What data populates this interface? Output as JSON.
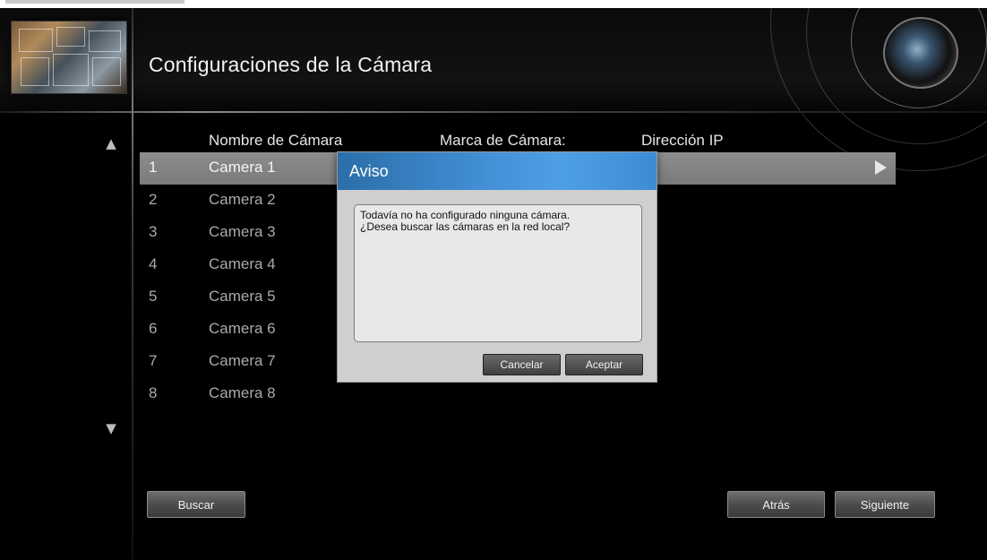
{
  "header": {
    "title": "Configuraciones de la Cámara"
  },
  "table": {
    "columns": [
      "Nombre de Cámara",
      "Marca de Cámara:",
      "Dirección IP"
    ],
    "rows": [
      {
        "num": "1",
        "name": "Camera 1"
      },
      {
        "num": "2",
        "name": "Camera 2"
      },
      {
        "num": "3",
        "name": "Camera 3"
      },
      {
        "num": "4",
        "name": "Camera 4"
      },
      {
        "num": "5",
        "name": "Camera 5"
      },
      {
        "num": "6",
        "name": "Camera 6"
      },
      {
        "num": "7",
        "name": "Camera 7"
      },
      {
        "num": "8",
        "name": "Camera 8"
      }
    ],
    "selected_row": "1"
  },
  "dialog": {
    "title": "Aviso",
    "message_line1": "Todavía no ha configurado ninguna cámara.",
    "message_line2": "¿Desea buscar las cámaras en la red local?",
    "cancel_label": "Cancelar",
    "accept_label": "Aceptar"
  },
  "footer": {
    "search_label": "Buscar",
    "back_label": "Atrás",
    "next_label": "Siguiente"
  },
  "icons": {
    "scroll_up": "up-arrow-icon",
    "scroll_down": "down-arrow-icon",
    "row_open": "play-icon"
  },
  "colors": {
    "dialog_titlebar": "#3f8bd0",
    "selected_row": "#8d8d8d",
    "background": "#000000"
  }
}
